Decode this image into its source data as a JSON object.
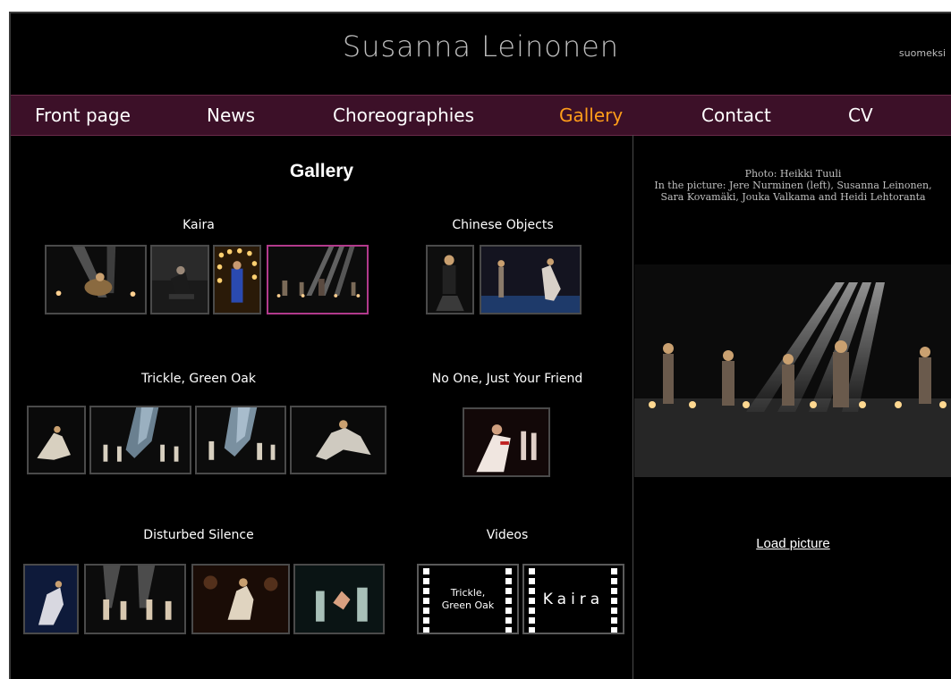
{
  "header": {
    "site_title": "Susanna Leinonen",
    "language_link": "suomeksi"
  },
  "nav": {
    "items": [
      {
        "label": "Front page"
      },
      {
        "label": "News"
      },
      {
        "label": "Choreographies"
      },
      {
        "label": "Gallery",
        "active": true
      },
      {
        "label": "Contact"
      },
      {
        "label": "CV"
      }
    ],
    "active_color": "#ff9d1a",
    "bar_color": "#3c1028"
  },
  "gallery": {
    "title": "Gallery",
    "groups": [
      {
        "title": "Kaira",
        "thumbnails": 4
      },
      {
        "title": "Chinese Objects",
        "thumbnails": 2
      },
      {
        "title": "Trickle, Green Oak",
        "thumbnails": 4
      },
      {
        "title": "No One, Just Your Friend",
        "thumbnails": 1
      },
      {
        "title": "Disturbed Silence",
        "thumbnails": 4
      },
      {
        "title": "Videos",
        "thumbnails": 2
      }
    ],
    "videos": [
      {
        "label": "Trickle,\nGreen Oak"
      },
      {
        "label": "Kaira"
      }
    ],
    "selected_border_color": "#b23a8c"
  },
  "photo_panel": {
    "caption_line1": "Photo: Heikki Tuuli",
    "caption_line2": "In the picture: Jere Nurminen (left), Susanna Leinonen, Sara Kovamäki, Jouka Valkama and Heidi Lehtoranta",
    "load_link": "Load picture"
  }
}
